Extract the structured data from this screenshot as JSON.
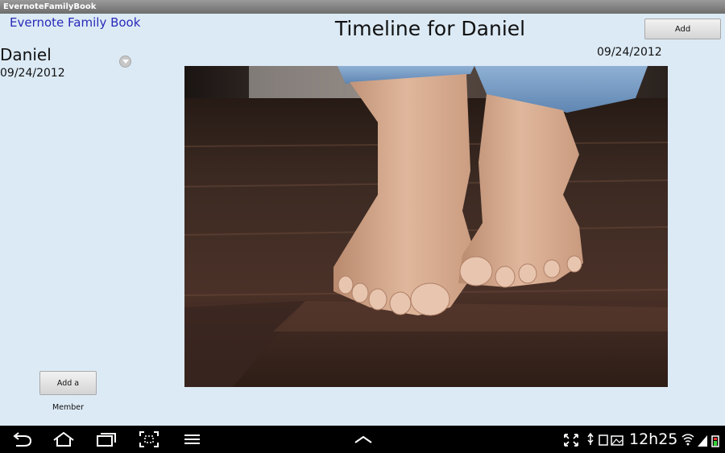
{
  "window": {
    "title": "EvernoteFamilyBook"
  },
  "app": {
    "link": "Evernote Family Book",
    "page_title": "Timeline for Daniel",
    "add_label": "Add",
    "add_member_label": "Add a Member"
  },
  "member": {
    "name": "Daniel",
    "date": "09/24/2012"
  },
  "entry": {
    "date": "09/24/2012"
  },
  "statusbar": {
    "time": "12h25"
  },
  "colors": {
    "background": "#dceaf5",
    "navbar": "#000000",
    "link": "#2a2ab8"
  }
}
